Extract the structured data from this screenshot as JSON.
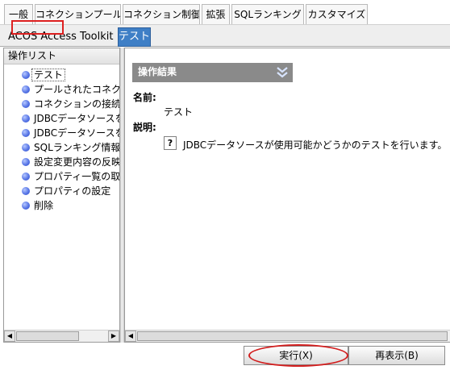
{
  "tabs_row1": [
    {
      "label": "一般"
    },
    {
      "label": "コネクションプール"
    },
    {
      "label": "コネクション制御"
    },
    {
      "label": "拡張"
    },
    {
      "label": "SQLランキング"
    },
    {
      "label": "カスタマイズ"
    }
  ],
  "tabs_row2": {
    "toolkit_label": "ACOS Access Toolkit",
    "active_tab": "テスト"
  },
  "left_panel": {
    "header": "操作リスト",
    "items": [
      {
        "label": "テスト",
        "selected": true
      },
      {
        "label": "プールされたコネクシ"
      },
      {
        "label": "コネクションの接続"
      },
      {
        "label": "JDBCデータソースを"
      },
      {
        "label": "JDBCデータソースを"
      },
      {
        "label": "SQLランキング情報"
      },
      {
        "label": "設定変更内容の反映"
      },
      {
        "label": "プロパティ一覧の取"
      },
      {
        "label": "プロパティの設定"
      },
      {
        "label": "削除"
      }
    ]
  },
  "right_panel": {
    "section_title": "操作結果",
    "name_label": "名前:",
    "name_value": "テスト",
    "description_label": "説明:",
    "description_value": "JDBCデータソースが使用可能かどうかのテストを行います。",
    "help_icon_text": "?"
  },
  "buttons": {
    "execute": "実行(X)",
    "refresh": "再表示(B)"
  },
  "colors": {
    "active_tab_bg": "#3f7fc6",
    "section_header_bg": "#8a8a8a",
    "annotation_red": "#dd2020",
    "bullet_blue": "#4a6fe0"
  },
  "icons": {
    "collapse": "double-chevron-down-icon",
    "bullet": "blue-circle-bullet-icon",
    "help": "question-mark-icon"
  }
}
